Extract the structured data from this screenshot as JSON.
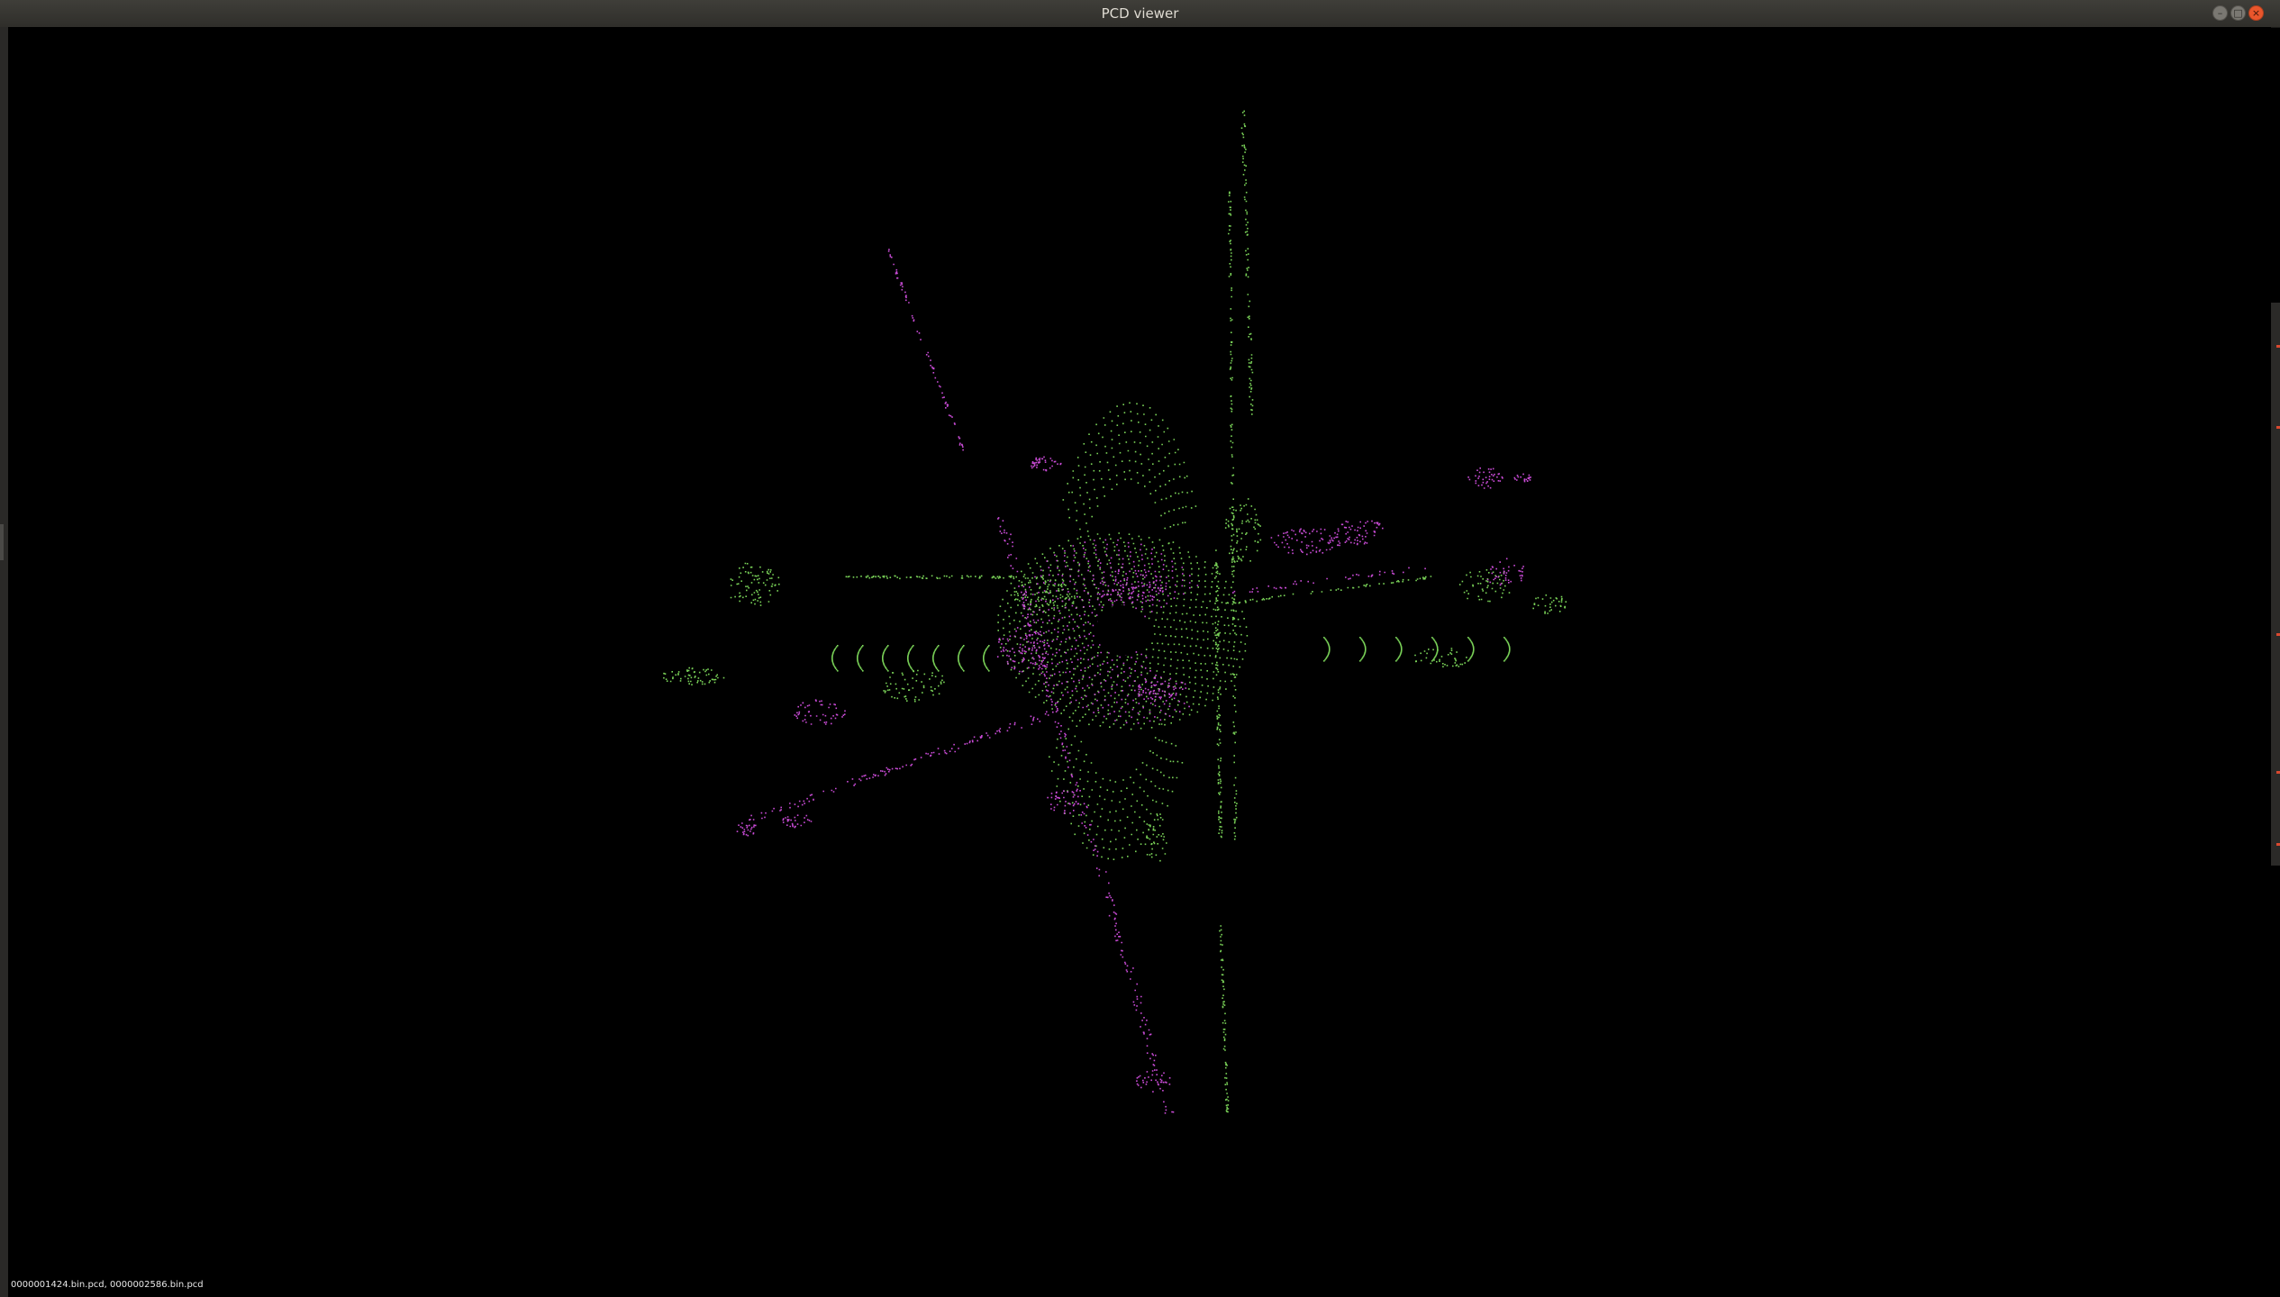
{
  "window": {
    "title": "PCD viewer",
    "buttons": {
      "minimize_icon": "minimize-icon",
      "maximize_icon": "maximize-icon",
      "close_icon": "close-icon"
    }
  },
  "viewer": {
    "background_color": "#000000",
    "source_cloud_color": "#7ad358",
    "target_cloud_color": "#c94bd6",
    "status_text": "0000001424.bin.pcd, 0000002586.bin.pcd"
  }
}
